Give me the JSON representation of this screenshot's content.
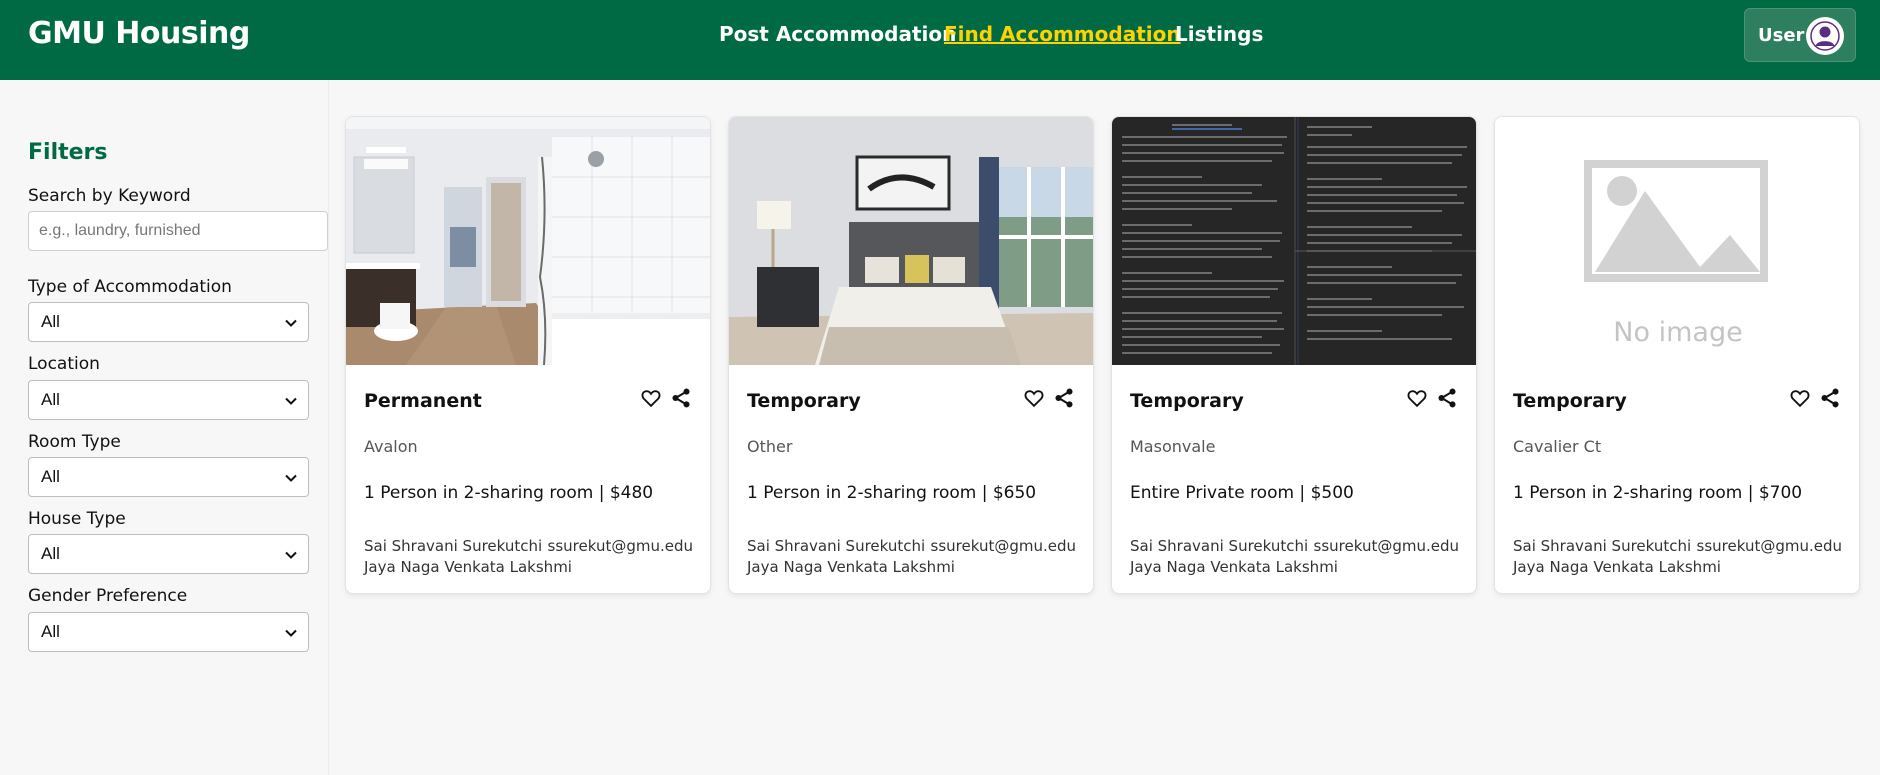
{
  "header": {
    "brand": "GMU Housing",
    "nav": [
      {
        "label": "Post Accommodation",
        "active": false
      },
      {
        "label": "Find Accommodation",
        "active": true
      },
      {
        "label": "Listings",
        "active": false
      }
    ],
    "user_label": "User",
    "colors": {
      "header_bg": "#006a44",
      "active_link": "#ffd200"
    }
  },
  "filters": {
    "title": "Filters",
    "keyword_label": "Search by Keyword",
    "keyword_placeholder": "e.g., laundry, furnished",
    "keyword_value": "",
    "selects": [
      {
        "label": "Type of Accommodation",
        "value": "All"
      },
      {
        "label": "Location",
        "value": "All"
      },
      {
        "label": "Room Type",
        "value": "All"
      },
      {
        "label": "House Type",
        "value": "All"
      },
      {
        "label": "Gender Preference",
        "value": "All"
      }
    ]
  },
  "listings": [
    {
      "type": "Permanent",
      "location": "Avalon",
      "room": "1 Person in 2-sharing room | $480",
      "owner_line1": "Sai Shravani Surekutchi",
      "owner_line2": "Jaya Naga Venkata Lakshmi",
      "email": "ssurekut@gmu.edu",
      "image": "bathroom-photo"
    },
    {
      "type": "Temporary",
      "location": "Other",
      "room": "1 Person in 2-sharing room | $650",
      "owner_line1": "Sai Shravani Surekutchi",
      "owner_line2": "Jaya Naga Venkata Lakshmi",
      "email": "ssurekut@gmu.edu",
      "image": "bedroom-photo"
    },
    {
      "type": "Temporary",
      "location": "Masonvale",
      "room": "Entire Private room | $500",
      "owner_line1": "Sai Shravani Surekutchi",
      "owner_line2": "Jaya Naga Venkata Lakshmi",
      "email": "ssurekut@gmu.edu",
      "image": "document-screenshot"
    },
    {
      "type": "Temporary",
      "location": "Cavalier Ct",
      "room": "1 Person in 2-sharing room | $700",
      "owner_line1": "Sai Shravani Surekutchi",
      "owner_line2": "Jaya Naga Venkata Lakshmi",
      "email": "ssurekut@gmu.edu",
      "image": "placeholder",
      "no_image_text": "No image"
    }
  ]
}
